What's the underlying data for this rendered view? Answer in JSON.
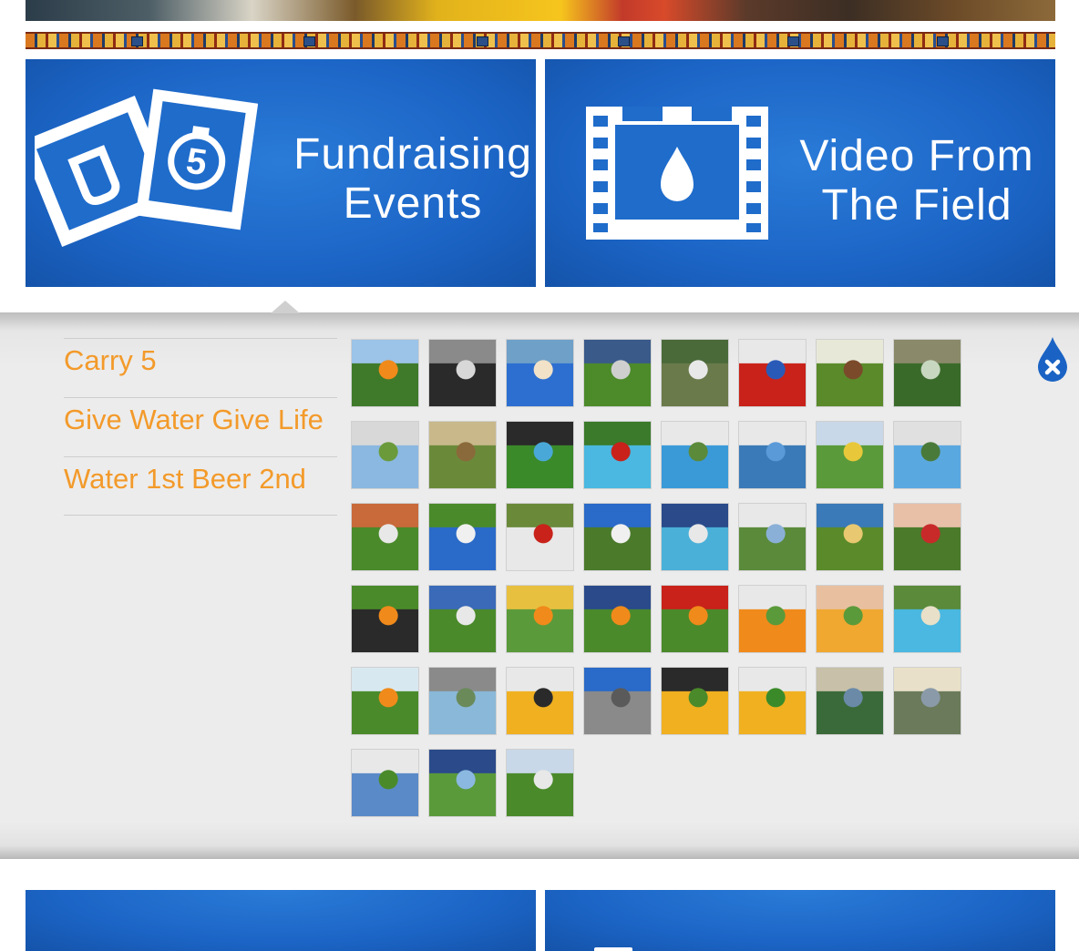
{
  "panels": {
    "fundraising": {
      "line1": "Fundraising",
      "line2": "Events",
      "icon_badge": "5"
    },
    "video": {
      "line1": "Video From",
      "line2": "The Field"
    }
  },
  "menu": {
    "items": [
      {
        "label": "Carry 5"
      },
      {
        "label": "Give Water Give Life"
      },
      {
        "label": "Water 1st Beer 2nd"
      }
    ]
  },
  "colors": {
    "panel_blue": "#1c65c6",
    "menu_orange": "#f39a2a",
    "gallery_bg": "#ececec"
  },
  "icons": {
    "fundraising": "photos-icon",
    "video": "film-strip-water-drop-icon",
    "close": "close-water-drop-icon"
  },
  "gallery": {
    "photos": [
      "photo-1",
      "photo-2",
      "photo-3",
      "photo-4",
      "photo-5",
      "photo-6",
      "photo-7",
      "photo-8",
      "photo-9",
      "photo-10",
      "photo-11",
      "photo-12",
      "photo-13",
      "photo-14",
      "photo-15",
      "photo-16",
      "photo-17",
      "photo-18",
      "photo-19",
      "photo-20",
      "photo-21",
      "photo-22",
      "photo-23",
      "photo-24",
      "photo-25",
      "photo-26",
      "photo-27",
      "photo-28",
      "photo-29",
      "photo-30",
      "photo-31",
      "photo-32",
      "photo-33",
      "photo-34",
      "photo-35",
      "photo-36",
      "photo-37",
      "photo-38",
      "photo-39",
      "photo-40",
      "photo-41",
      "photo-42",
      "photo-43"
    ]
  }
}
